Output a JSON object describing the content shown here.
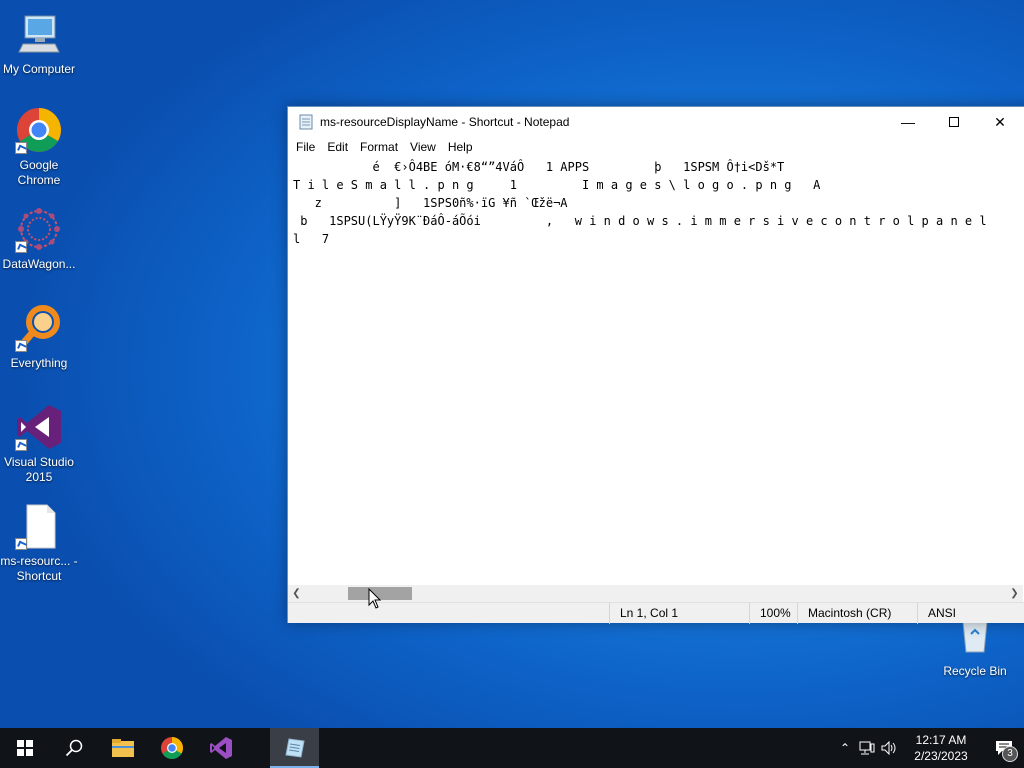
{
  "desktop": {
    "icons": [
      {
        "label": "My Computer",
        "icon": "computer-icon"
      },
      {
        "label": "Google Chrome",
        "icon": "chrome-icon"
      },
      {
        "label": "DataWagon...",
        "icon": "datawagon-icon"
      },
      {
        "label": "Everything",
        "icon": "everything-search-icon"
      },
      {
        "label": "Visual Studio 2015",
        "icon": "visual-studio-icon"
      },
      {
        "label": "ms-resourc... - Shortcut",
        "icon": "file-icon"
      },
      {
        "label": "Recycle Bin",
        "icon": "recycle-bin-icon"
      }
    ]
  },
  "notepad": {
    "title": "ms-resourceDisplayName - Shortcut - Notepad",
    "menu": [
      "File",
      "Edit",
      "Format",
      "View",
      "Help"
    ],
    "content": "           é  €›Ô4BE óM·€8“”4VáÔ   1 APPS         þ   1SPSM Ô†i<Dš*T\nT i l e S m a l l . p n g     1         I m a g e s \\ l o g o . p n g   A           \n   z          ]   1SPS0ñ%·ïG ¥ñ `Œžë¬A\n b   1SPSU(LŸyŸ9K¨ÐáÔ-áÕói         ,   w i n d o w s . i m m e r s i v e c o n t r o l p a n e l\nl   7",
    "status": {
      "position": "Ln 1, Col 1",
      "zoom": "100%",
      "line_ending": "Macintosh (CR)",
      "encoding": "ANSI"
    }
  },
  "taskbar": {
    "apps": [
      "start-icon",
      "search-icon",
      "file-explorer-icon",
      "chrome-icon",
      "visual-studio-icon",
      "notepad-icon"
    ],
    "time": "12:17 AM",
    "date": "2/23/2023",
    "notification_count": "3"
  }
}
